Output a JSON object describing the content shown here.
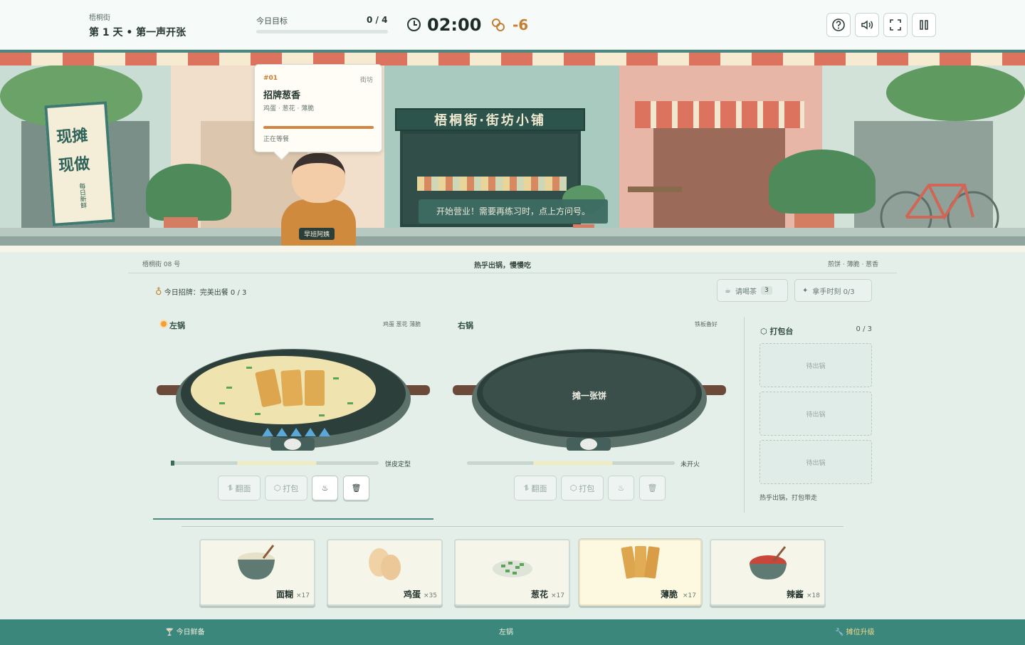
{
  "hud": {
    "location": "梧桐街",
    "day_title": "第 1 天 • 第一声开张",
    "goal_label": "今日目标",
    "goal_value": "0 / 4",
    "goal_progress": 0,
    "timer": "02:00",
    "coins": "-6",
    "buttons": [
      "help-icon",
      "volume-icon",
      "fullscreen-icon",
      "pause-icon"
    ]
  },
  "scene": {
    "banner_line1": "现摊",
    "banner_line2": "现做",
    "banner_small": "每日新鲜",
    "shop_sign": "梧桐街·街坊小铺",
    "order": {
      "number": "#01",
      "tag": "街坊",
      "name": "招牌葱香",
      "ingredients": "鸡蛋 · 葱花 · 薄脆",
      "patience": 1.0,
      "status": "正在等餐"
    },
    "customer_name": "早班阿姨",
    "toast": "开始营业！需要再练习时，点上方问号。"
  },
  "kitchen": {
    "stall_no": "梧桐街 08 号",
    "slogan": "热乎出锅，慢慢吃",
    "menu_hint": "煎饼 · 薄脆 · 葱香",
    "challenge_label": "今日招牌：完美出餐 0 / 3",
    "tea_button": "请喝茶",
    "tea_count": "3",
    "skill_button": "拿手时刻 0/3",
    "left_pan": {
      "label": "左锅",
      "toppings": "鸡蛋 葱花 薄脆",
      "status": "饼皮定型",
      "flip": "翻面",
      "pack": "打包"
    },
    "right_pan": {
      "label": "右锅",
      "hint": "铁板备好",
      "center_text": "摊一张饼",
      "status": "未开火",
      "flip": "翻面",
      "pack": "打包"
    },
    "packing": {
      "title": "打包台",
      "count": "0 / 3",
      "slots": [
        "待出锅",
        "待出锅",
        "待出锅"
      ],
      "hint": "热乎出锅，打包带走"
    }
  },
  "ingredients": [
    {
      "name": "面糊",
      "count": "×17"
    },
    {
      "name": "鸡蛋",
      "count": "×35"
    },
    {
      "name": "葱花",
      "count": "×17"
    },
    {
      "name": "薄脆",
      "count": "×17"
    },
    {
      "name": "辣酱",
      "count": "×18"
    }
  ],
  "footer": {
    "left": "今日鲜备",
    "middle": "左锅",
    "right": "摊位升级"
  },
  "colors": {
    "accent": "#3b877c",
    "coin": "#c57f30",
    "awning_red": "#dc735e",
    "awning_cream": "#f6ead0"
  }
}
